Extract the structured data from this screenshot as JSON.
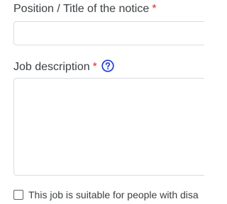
{
  "form": {
    "position_title": {
      "label": "Position / Title of the notice",
      "required_mark": "*",
      "value": "",
      "placeholder": ""
    },
    "job_description": {
      "label": "Job description",
      "required_mark": "*",
      "help_icon": "question-circle-icon",
      "value": "",
      "placeholder": ""
    },
    "disability_checkbox": {
      "label": "This job is suitable for people with disa",
      "checked": false
    }
  },
  "colors": {
    "required": "#d93025",
    "help_icon": "#1a3fd6",
    "field_border": "#dadce0",
    "label_text": "#3c4043"
  }
}
